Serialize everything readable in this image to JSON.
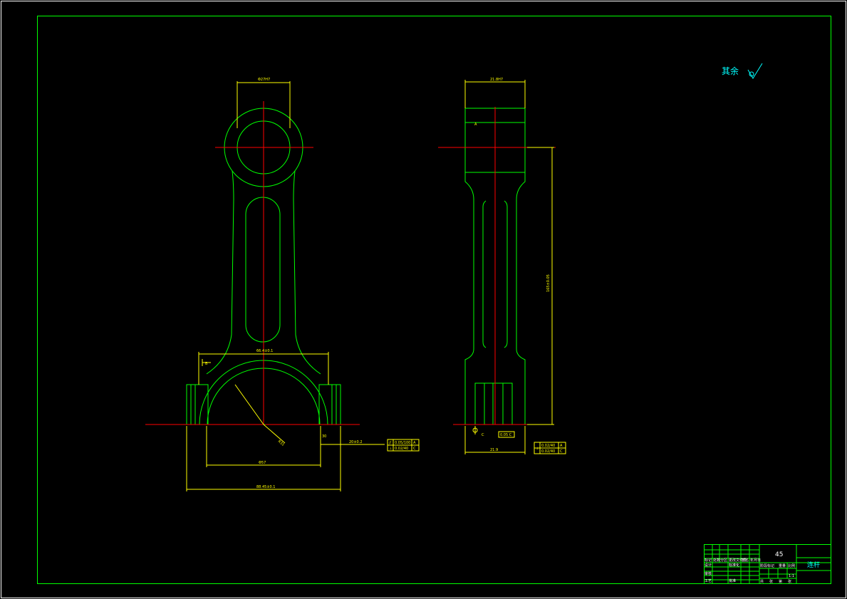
{
  "drawing": {
    "roughness_note": "其余",
    "dims_front": {
      "top_bore": "Φ27H7",
      "big_end_width": "66.4±0.1",
      "overall_width": "88.45±0.1",
      "bore_dia": "Φ57",
      "radius": "R31",
      "datum_mark": "B",
      "step": "30"
    },
    "dims_side": {
      "top_width": "21.8H7",
      "center_distance": "165±0.05",
      "bottom_width": "21.9",
      "datum_mark": "C",
      "small_mark": "A",
      "feature_frame": "0.05 C"
    },
    "tolerance_front": {
      "row1_symbol": "//",
      "row1_value": "0.05/100",
      "row1_datum": "A",
      "row2_symbol": "⊥",
      "row2_value": "0.02/40",
      "row2_datum": "C",
      "side_dim": "20±0.2"
    },
    "tolerance_side": {
      "row1_symbol": "⊥",
      "row1_value": "0.02/40",
      "row1_datum": "A",
      "row2_value": "0.02/40",
      "row2_datum": "C"
    },
    "title_block": {
      "material": "45",
      "part_name": "连杆",
      "scale": "1:1",
      "label_design": "设计",
      "label_check": "审核",
      "label_process": "工艺",
      "label_approve": "批准",
      "label_stage": "阶段标记",
      "label_weight": "重量",
      "label_ratio": "比例",
      "label_sheets_a": "共",
      "label_sheets_b": "张",
      "label_sheet_c": "第",
      "label_sheet_d": "张",
      "label_standard": "标准化",
      "label_sign": "签名",
      "label_date": "年月日",
      "label_mark": "标记",
      "label_count": "处数",
      "label_zone": "分区",
      "label_change": "更改文件号"
    }
  },
  "colors": {
    "outline": "#00ff00",
    "center": "#ff0000",
    "dimension": "#ffff00",
    "note": "#00ffff"
  }
}
